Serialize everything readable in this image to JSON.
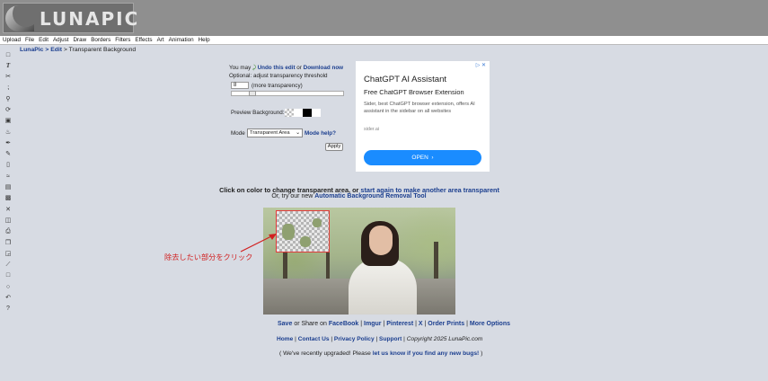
{
  "header": {
    "logo_text": "LUNAPIC"
  },
  "menu": [
    "Upload",
    "File",
    "Edit",
    "Adjust",
    "Draw",
    "Borders",
    "Filters",
    "Effects",
    "Art",
    "Animation",
    "Help"
  ],
  "breadcrumb": {
    "root": "LunaPic",
    "sep1": " > ",
    "section": "Edit",
    "sep2": " > ",
    "current": "Transparent Background"
  },
  "toolbar_icons": [
    "select-icon",
    "text-icon",
    "scissors-icon",
    "brush-icon",
    "zoom-icon",
    "rotate-icon",
    "crop-icon",
    "fill-icon",
    "eyedropper-icon",
    "pencil-icon",
    "eraser-icon",
    "smudge-icon",
    "layers-icon",
    "save-icon",
    "close-icon",
    "new-icon",
    "print-icon",
    "copy-icon",
    "paste-icon",
    "line-icon",
    "rectangle-icon",
    "circle-icon",
    "undo-icon",
    "help-icon"
  ],
  "controls": {
    "you_may": "You may",
    "undo_label": "Undo this edit",
    "or": "or",
    "download_label": "Download now",
    "optional_text": "Optional: adjust transparency threshold",
    "threshold_value": "8",
    "threshold_hint": "(more transparency)",
    "slider_fraction": 0.16,
    "preview_label": "Preview Background:",
    "preview_swatches": [
      "checker",
      "#ffffff",
      "#000000",
      "#ffffff"
    ],
    "mode_label": "Mode",
    "mode_selected": "Transparent Area",
    "mode_help": "Mode help?",
    "apply_label": "Apply"
  },
  "ad": {
    "title": "ChatGPT AI Assistant",
    "subtitle": "Free ChatGPT Browser Extension",
    "body": "Sider, best ChatGPT browser extension, offers AI assistant in the sidebar on all websites",
    "domain": "sider.ai",
    "cta": "OPEN",
    "cta_icon": "chevron-right-icon"
  },
  "instructions": {
    "line1_text": "Click on color to change transparent area, or ",
    "line1_link": "start again to make another area transparent",
    "line2_text": "Or, try our new ",
    "line2_link": "Automatic Background Removal Tool"
  },
  "annotation": {
    "text": "除去したい部分をクリック",
    "color": "#d11f1f"
  },
  "footer": {
    "save": "Save",
    "share_text": "or Share on",
    "facebook": "FaceBook",
    "imgur": "Imgur",
    "pinterest": "Pinterest",
    "x": "X",
    "order_prints": "Order Prints",
    "more_options": "More Options",
    "home": "Home",
    "contact": "Contact Us",
    "privacy": "Privacy Policy",
    "support": "Support",
    "copyright": "Copyright 2025 ",
    "brand": "LunaPic.com",
    "upgrade_pre": "( We've recently upgraded! Please ",
    "upgrade_link": "let us know if you find any new bugs!",
    "upgrade_post": " )"
  }
}
